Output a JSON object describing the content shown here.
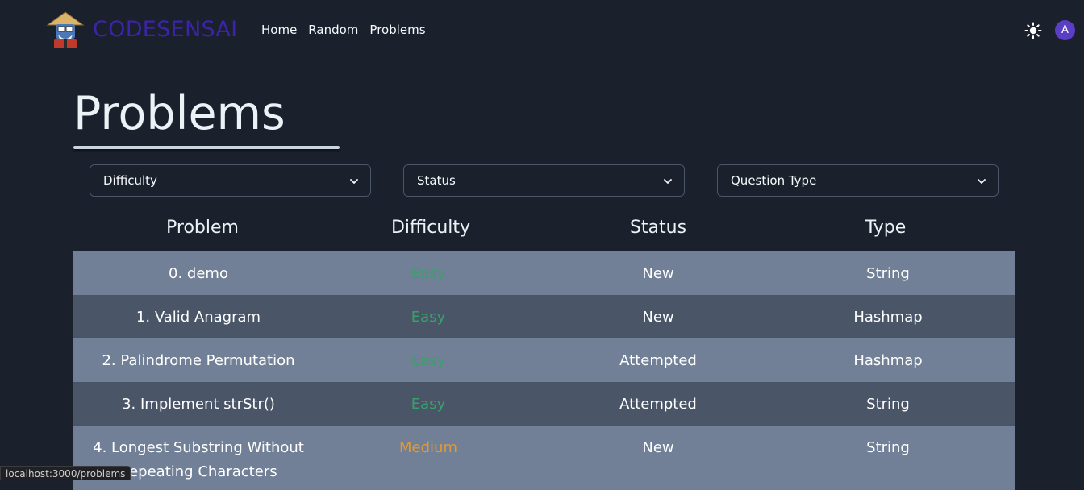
{
  "nav": {
    "brand": "CODESENSAI",
    "links": [
      "Home",
      "Random",
      "Problems"
    ],
    "avatar_initial": "A"
  },
  "page": {
    "title": "Problems"
  },
  "filters": [
    {
      "label": "Difficulty"
    },
    {
      "label": "Status"
    },
    {
      "label": "Question Type"
    }
  ],
  "table": {
    "headers": [
      "Problem",
      "Difficulty",
      "Status",
      "Type"
    ],
    "rows": [
      {
        "problem": "0. demo",
        "difficulty": "Easy",
        "status": "New",
        "type": "String"
      },
      {
        "problem": "1. Valid Anagram",
        "difficulty": "Easy",
        "status": "New",
        "type": "Hashmap"
      },
      {
        "problem": "2. Palindrome Permutation",
        "difficulty": "Easy",
        "status": "Attempted",
        "type": "Hashmap"
      },
      {
        "problem": "3. Implement strStr()",
        "difficulty": "Easy",
        "status": "Attempted",
        "type": "String"
      },
      {
        "problem": "4. Longest Substring Without Repeating Characters",
        "difficulty": "Medium",
        "status": "New",
        "type": "String"
      }
    ]
  },
  "statusbar": {
    "url": "localhost:3000/problems"
  },
  "colors": {
    "background": "#1a202c",
    "brand": "#3b24a8",
    "easy": "#38a169",
    "medium": "#dd9a36",
    "row_light": "#718096",
    "row_dark": "#4a5568",
    "avatar": "#5a3fc6"
  },
  "icons": {
    "logo": "sensei-logo-icon",
    "theme": "sun-icon",
    "dropdown": "chevron-down-icon"
  }
}
